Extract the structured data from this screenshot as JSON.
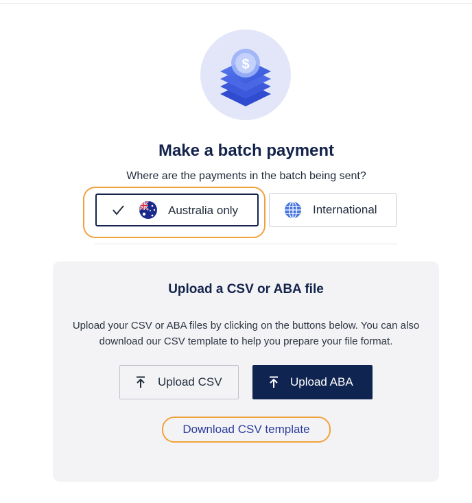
{
  "page": {
    "title": "Make a batch payment",
    "question": "Where are the payments in the batch being sent?"
  },
  "hero": {
    "icon": "stacked-money-dollar-icon"
  },
  "destination_options": [
    {
      "label": "Australia only",
      "selected": true,
      "icon": "australia-flag-icon"
    },
    {
      "label": "International",
      "selected": false,
      "icon": "globe-icon"
    }
  ],
  "upload_card": {
    "title": "Upload a CSV or ABA file",
    "description": "Upload your CSV or ABA files by clicking on the buttons below. You can also download our CSV template to help you prepare your file format.",
    "upload_csv_label": "Upload CSV",
    "upload_aba_label": "Upload ABA",
    "download_template_label": "Download CSV template"
  },
  "colors": {
    "navy": "#0f2450",
    "highlight": "#f0a23a",
    "link": "#2c3c9c",
    "card_bg": "#f3f3f6",
    "hero_bg": "#e2e6f8"
  }
}
